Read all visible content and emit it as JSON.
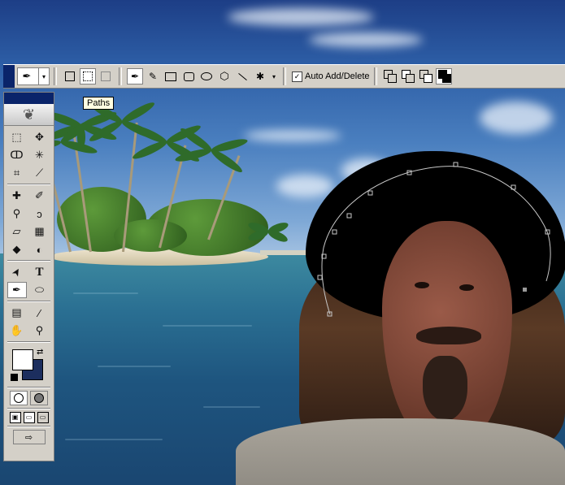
{
  "options_bar": {
    "auto_add_delete_label": "Auto Add/Delete",
    "auto_add_delete_checked": true,
    "pen_glyph": "✒",
    "freeform_glyph": "✎",
    "custom_shape_glyph": "✱",
    "dropdown_glyph": "▾"
  },
  "tooltip": {
    "text": "Paths"
  },
  "toolbox": {
    "tools": [
      {
        "name": "marquee-tool",
        "glyph": "⬚"
      },
      {
        "name": "move-tool",
        "glyph": "✥"
      },
      {
        "name": "lasso-tool",
        "glyph": "ↀ"
      },
      {
        "name": "magic-wand-tool",
        "glyph": "✳"
      },
      {
        "name": "crop-tool",
        "glyph": "⌗"
      },
      {
        "name": "slice-tool",
        "glyph": "⟋"
      },
      {
        "name": "healing-brush-tool",
        "glyph": "✚"
      },
      {
        "name": "brush-tool",
        "glyph": "✐"
      },
      {
        "name": "clone-stamp-tool",
        "glyph": "⚲"
      },
      {
        "name": "history-brush-tool",
        "glyph": "ↄ"
      },
      {
        "name": "eraser-tool",
        "glyph": "▱"
      },
      {
        "name": "gradient-tool",
        "glyph": "▦"
      },
      {
        "name": "blur-tool",
        "glyph": "◆"
      },
      {
        "name": "dodge-tool",
        "glyph": "◐"
      },
      {
        "name": "path-selection-tool",
        "glyph": "➤"
      },
      {
        "name": "type-tool",
        "glyph": "T"
      },
      {
        "name": "pen-tool",
        "glyph": "✒"
      },
      {
        "name": "ellipse-tool",
        "glyph": "⬭"
      },
      {
        "name": "notes-tool",
        "glyph": "▤"
      },
      {
        "name": "eyedropper-tool",
        "glyph": "⁄"
      },
      {
        "name": "hand-tool",
        "glyph": "✋"
      },
      {
        "name": "zoom-tool",
        "glyph": "⚲"
      }
    ],
    "swap_glyph": "⇄",
    "jump_glyph": "⇨"
  },
  "colors": {
    "foreground": "#ffffff",
    "background": "#1c2e5e",
    "ui_face": "#d4d0c8",
    "title_bar": "#0a246a",
    "tooltip_bg": "#ffffe1"
  }
}
